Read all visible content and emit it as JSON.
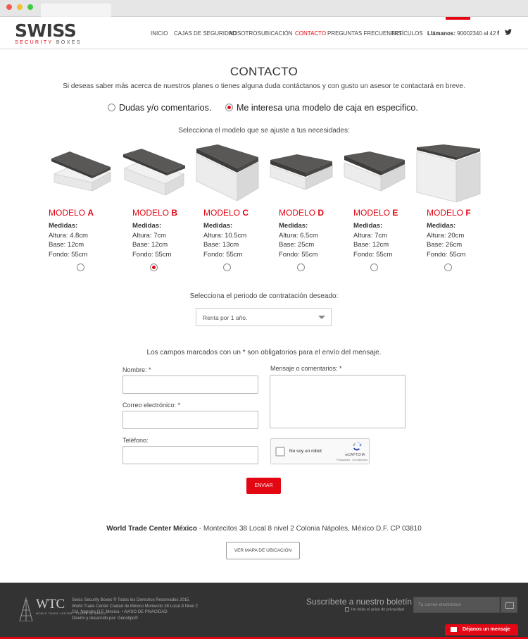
{
  "brand": {
    "name": "SWISS",
    "sub_red": "SECURITY",
    "sub_rest": " BOXES"
  },
  "nav": {
    "items": [
      "INICIO",
      "CAJAS DE SEGURIDAD",
      "NOSOTROS",
      "UBICACIÓN",
      "CONTACTO",
      "PREGUNTAS FRECUENTES",
      "ARTÍCULOS"
    ],
    "active": "CONTACTO"
  },
  "header": {
    "phone_label": "Llámanos:",
    "phone_number": " 90002340 al 42",
    "social": [
      "f",
      "twitter"
    ]
  },
  "page": {
    "title": "CONTACTO",
    "intro": "Si deseas saber más acerca de nuestros planes o tienes alguna duda contáctanos y con gusto un asesor te contactará en breve."
  },
  "contact_type": {
    "options": [
      "Dudas y/o comentarios.",
      "Me interesa una modelo de caja en especifico."
    ],
    "selected": 1
  },
  "models": {
    "prompt": "Selecciona el modelo que se ajuste a tus necesidades:",
    "word": "MODELO",
    "spec_title": "Medidas:",
    "selected": "B",
    "items": [
      {
        "letter": "A",
        "altura": "Altura: 4.8cm",
        "base": "Base: 12cm",
        "fondo": "Fondo: 55cm"
      },
      {
        "letter": "B",
        "altura": "Altura: 7cm",
        "base": "Base: 12cm",
        "fondo": "Fondo: 55cm"
      },
      {
        "letter": "C",
        "altura": "Altura: 10.5cm",
        "base": "Base: 13cm",
        "fondo": "Fondo: 55cm"
      },
      {
        "letter": "D",
        "altura": "Altura: 6.5cm",
        "base": "Base: 25cm",
        "fondo": "Fondo: 55cm"
      },
      {
        "letter": "E",
        "altura": "Altura: 7cm",
        "base": "Base: 12cm",
        "fondo": "Fondo: 55cm"
      },
      {
        "letter": "F",
        "altura": "Altura: 20cm",
        "base": "Base: 26cm",
        "fondo": "Fondo: 55cm"
      }
    ]
  },
  "period": {
    "prompt": "Selecciona el periodo de contratación deseado:",
    "value": "Renta por 1 año."
  },
  "form": {
    "required_note": "Los campos marcados con un * son obligatorios para el envío del mensaje.",
    "name_label": "Nombre: *",
    "email_label": "Correo electrónico: *",
    "phone_label": "Teléfono:",
    "message_label": "Mensaje o comentarios: *",
    "captcha_text": "No soy un robot",
    "captcha_brand": "reCAPTCHA",
    "captcha_links": "Privacidad · Condiciones",
    "submit": "ENVIAR"
  },
  "location": {
    "place": "World Trade Center México",
    "address": " - Montecitos 38 Local 8 nivel 2 Colonia Nápoles, México D.F. CP 03810",
    "map_button": "VER MAPA DE UBICACIÓN"
  },
  "footer": {
    "wtc_logo": "WTC",
    "wtc_logo_sub": "WORLD TRADE CENTER · CIUDAD DE MÉXICO",
    "legal": [
      "Swiss Security Boxes ® Todos los Derechos Reservados 2015.",
      "World Trade Center Ciudad de México Montecito 38 Local 8 Nivel 2",
      "Col. Napoles D.F. México.  •  AVISO DE PIVACIDAD",
      "Diseño y desarrollo por: Genotipo®"
    ],
    "newsletter_title": "Suscríbete a nuestro boletín",
    "newsletter_check": "He leído el aviso de privacidad",
    "newsletter_placeholder": "Tu correo electrónico",
    "message_tab": "Déjanos un mensaje"
  },
  "colors": {
    "accent": "#e30613",
    "footer_bg": "#333333"
  }
}
